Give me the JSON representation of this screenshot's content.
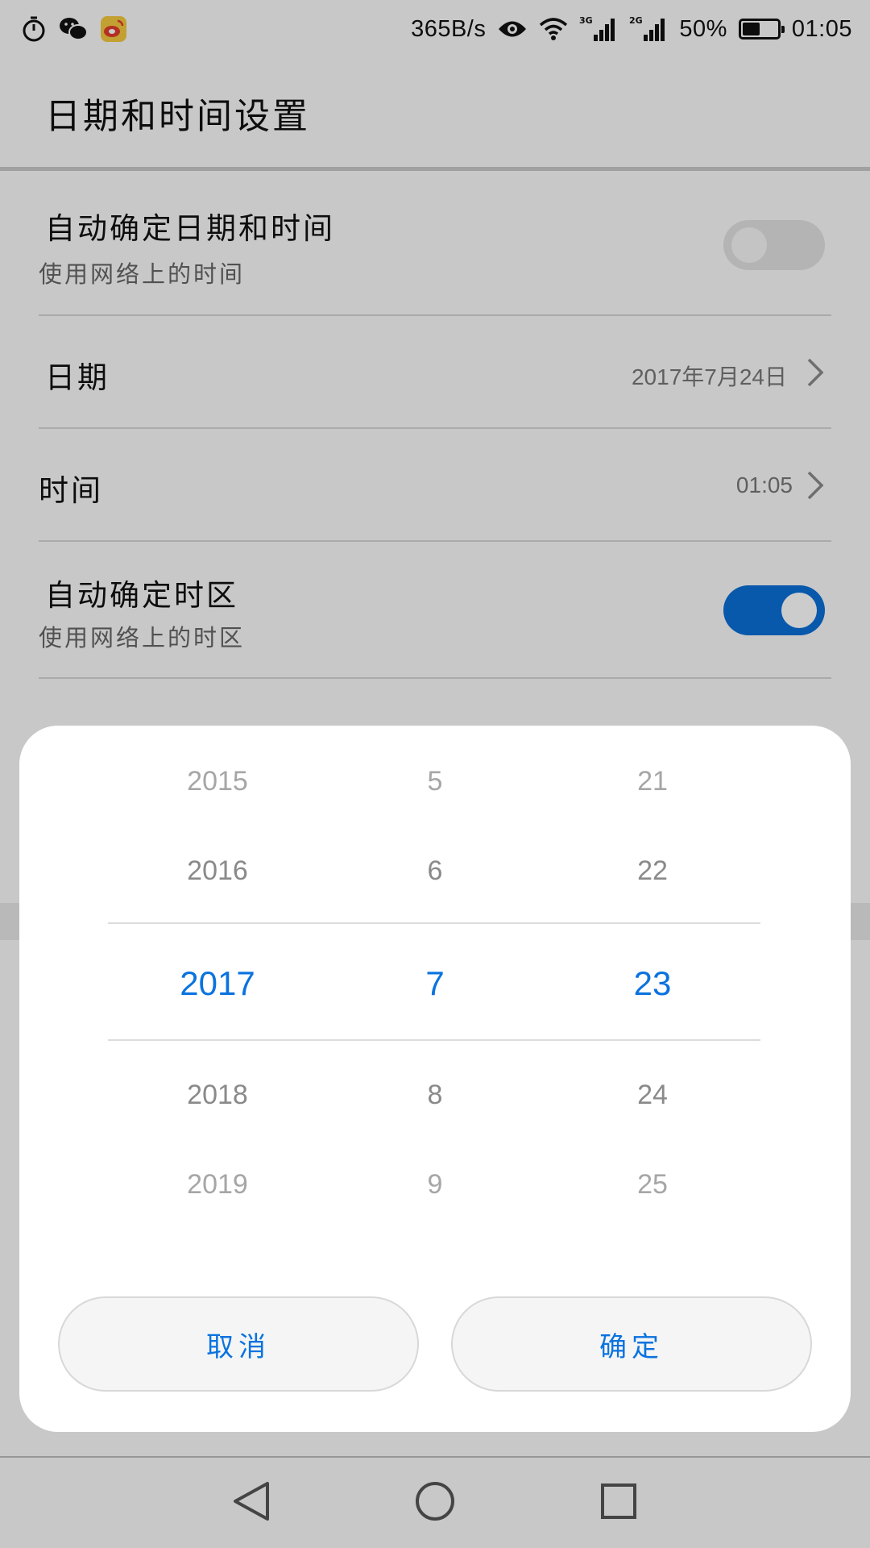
{
  "status_bar": {
    "left_icons": [
      "stopwatch-icon",
      "wechat-icon",
      "weibo-icon"
    ],
    "net_speed": "365B/s",
    "network_3g": "3G",
    "network_2g": "2G",
    "battery_percent": "50%",
    "battery_level": 0.5,
    "time": "01:05"
  },
  "app_bar": {
    "title": "日期和时间设置"
  },
  "settings": {
    "auto_datetime": {
      "title": "自动确定日期和时间",
      "subtitle": "使用网络上的时间",
      "enabled": false
    },
    "date": {
      "title": "日期",
      "value": "2017年7月24日"
    },
    "time": {
      "title": "时间",
      "value": "01:05"
    },
    "auto_timezone": {
      "title": "自动确定时区",
      "subtitle": "使用网络上的时区",
      "enabled": true
    }
  },
  "date_picker": {
    "years": [
      "2015",
      "2016",
      "2017",
      "2018",
      "2019"
    ],
    "months": [
      "5",
      "6",
      "7",
      "8",
      "9"
    ],
    "days": [
      "21",
      "22",
      "23",
      "24",
      "25"
    ],
    "selected": {
      "year": "2017",
      "month": "7",
      "day": "23"
    },
    "cancel_label": "取消",
    "confirm_label": "确定"
  },
  "colors": {
    "accent": "#0a73df",
    "toggle_on": "#0a6fd8",
    "toggle_off": "#e1e1e1"
  },
  "nav_bar": {
    "icons": [
      "back-icon",
      "home-icon",
      "recents-icon"
    ]
  }
}
